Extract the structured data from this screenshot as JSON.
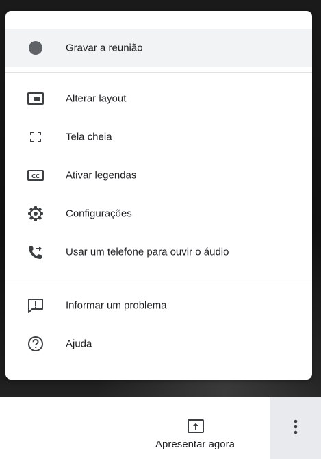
{
  "menu": {
    "items": [
      {
        "label": "Gravar a reunião",
        "icon": "record-dot-icon"
      },
      {
        "label": "Alterar layout",
        "icon": "layout-icon"
      },
      {
        "label": "Tela cheia",
        "icon": "fullscreen-icon"
      },
      {
        "label": "Ativar legendas",
        "icon": "closed-captions-icon"
      },
      {
        "label": "Configurações",
        "icon": "gear-icon"
      },
      {
        "label": "Usar um telefone para ouvir o áudio",
        "icon": "phone-forward-icon"
      },
      {
        "label": "Informar um problema",
        "icon": "feedback-icon"
      },
      {
        "label": "Ajuda",
        "icon": "help-icon"
      }
    ]
  },
  "bottom_bar": {
    "present_label": "Apresentar agora",
    "present_icon": "present-upload-icon",
    "more_icon": "more-vertical-icon"
  },
  "colors": {
    "menu_background": "#ffffff",
    "highlight": "#f1f3f4",
    "text": "#202124",
    "icon": "#3c4043",
    "more_button_bg": "#e8eaed"
  }
}
